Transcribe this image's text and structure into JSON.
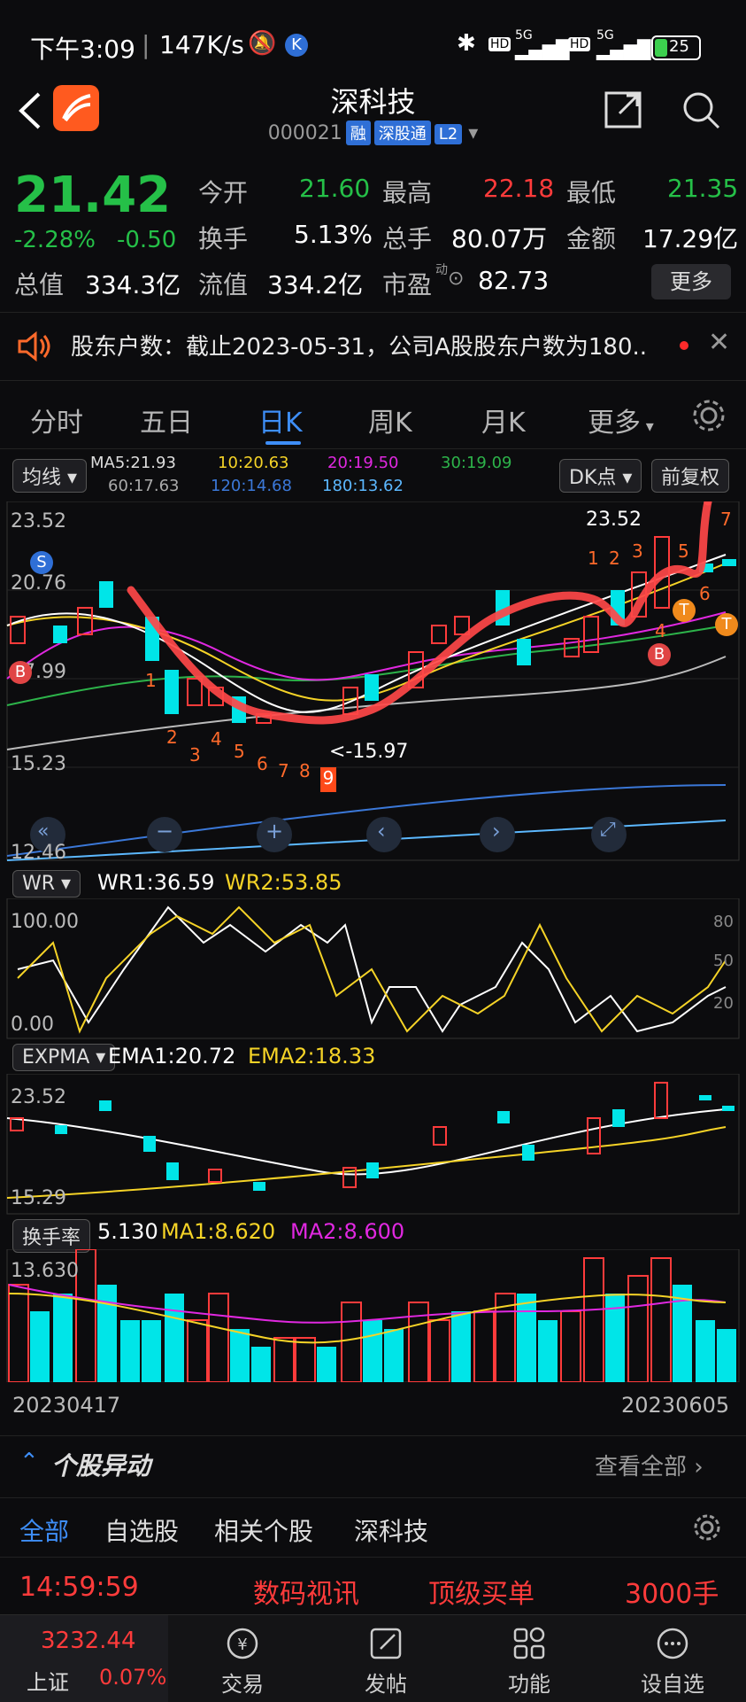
{
  "status_bar": {
    "time": "下午3:09",
    "speed": "147K/s",
    "battery": "25",
    "signal1": "5G",
    "signal2": "5G",
    "hd1": "HD",
    "hd2": "HD"
  },
  "header": {
    "title": "深科技",
    "code": "000021",
    "tags": [
      "融",
      "深股通",
      "L2"
    ]
  },
  "quote": {
    "price": "21.42",
    "change_pct": "-2.28%",
    "change": "-0.50",
    "open_label": "今开",
    "open": "21.60",
    "high_label": "最高",
    "high": "22.18",
    "low_label": "最低",
    "low": "21.35",
    "turnover_label": "换手",
    "turnover": "5.13%",
    "volume_label": "总手",
    "volume": "80.07万",
    "amount_label": "金额",
    "amount": "17.29亿",
    "mktcap_label": "总值",
    "mktcap": "334.3亿",
    "float_label": "流值",
    "float_cap": "334.2亿",
    "pe_label": "市盈",
    "pe_sup": "动",
    "pe": "82.73",
    "more": "更多"
  },
  "news": {
    "text": "股东户数：截止2023-05-31，公司A股股东户数为180.."
  },
  "tabs": [
    "分时",
    "五日",
    "日K",
    "周K",
    "月K",
    "更多"
  ],
  "active_tab": 2,
  "ma": {
    "selector": "均线",
    "ma5": "MA5:21.93",
    "ma10": "10:20.63",
    "ma20": "20:19.50",
    "ma30": "30:19.09",
    "ma60": "60:17.63",
    "ma120": "120:14.68",
    "ma180": "180:13.62",
    "dk": "DK点",
    "adjust": "前复权",
    "y_labels": [
      "23.52",
      "20.76",
      "17.99",
      "15.23",
      "12.46"
    ],
    "high_mark": "23.52",
    "low_mark": "<-15.97",
    "seq_left": [
      "1",
      "2",
      "3",
      "4",
      "5",
      "6",
      "7",
      "8",
      "9"
    ],
    "seq_right": [
      "1",
      "2",
      "3",
      "4",
      "5",
      "6",
      "7"
    ],
    "sig_s": "S",
    "sig_b": "B",
    "sig_t": "T"
  },
  "wr": {
    "name": "WR",
    "wr1": "WR1:36.59",
    "wr2": "WR2:53.85",
    "y_top": "100.00",
    "y_bot": "0.00",
    "r80": "80",
    "r50": "50",
    "r20": "20"
  },
  "expma": {
    "name": "EXPMA",
    "ema1": "EMA1:20.72",
    "ema2": "EMA2:18.33",
    "y_top": "23.52",
    "y_bot": "15.29"
  },
  "turnover_ind": {
    "name": "换手率",
    "value": "5.130",
    "ma1": "MA1:8.620",
    "ma2": "MA2:8.600",
    "y_top": "13.630",
    "date_start": "20230417",
    "date_end": "20230605"
  },
  "abnormal": {
    "title": "个股异动",
    "view_all": "查看全部",
    "tabs": [
      "全部",
      "自选股",
      "相关个股",
      "深科技"
    ],
    "row": {
      "time": "14:59:59",
      "source": "数码视讯",
      "type": "顶级买单",
      "amount": "3000手"
    }
  },
  "bottom": {
    "index_value": "3232.44",
    "index_name": "上证",
    "index_pct": "0.07%",
    "items": [
      "交易",
      "发帖",
      "功能",
      "设自选"
    ]
  },
  "colors": {
    "up": "#ff3b3b",
    "down": "#00e5e8",
    "accent": "#3e8ef7"
  }
}
